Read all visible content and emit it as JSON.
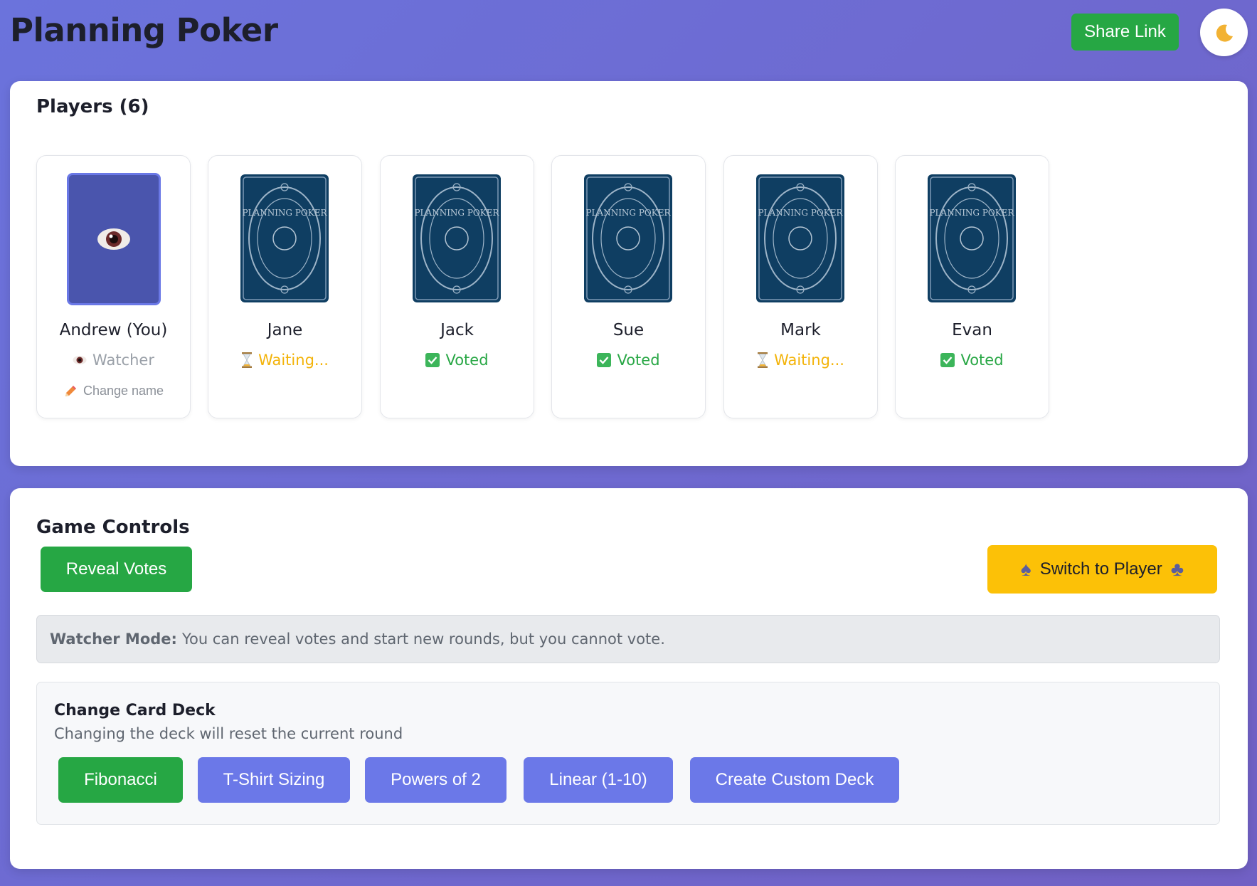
{
  "header": {
    "title": "Planning Poker",
    "share_label": "Share Link",
    "theme_icon": "moon-icon"
  },
  "players": {
    "title": "Players (6)",
    "list": [
      {
        "name": "Andrew (You)",
        "status": "Watcher",
        "status_type": "watcher",
        "card": "watcher-eye",
        "change_name": "Change name"
      },
      {
        "name": "Jane",
        "status": "Waiting...",
        "status_type": "waiting",
        "card": "card-back"
      },
      {
        "name": "Jack",
        "status": "Voted",
        "status_type": "voted",
        "card": "card-back"
      },
      {
        "name": "Sue",
        "status": "Voted",
        "status_type": "voted",
        "card": "card-back"
      },
      {
        "name": "Mark",
        "status": "Waiting...",
        "status_type": "waiting",
        "card": "card-back"
      },
      {
        "name": "Evan",
        "status": "Voted",
        "status_type": "voted",
        "card": "card-back"
      }
    ]
  },
  "controls": {
    "title": "Game Controls",
    "reveal_label": "Reveal Votes",
    "switch_label": "Switch to Player",
    "notice_bold": "Watcher Mode:",
    "notice_text": "You can reveal votes and start new rounds, but you cannot vote.",
    "deck": {
      "title": "Change Card Deck",
      "subtitle": "Changing the deck will reset the current round",
      "options": [
        {
          "label": "Fibonacci",
          "active": true
        },
        {
          "label": "T-Shirt Sizing",
          "active": false
        },
        {
          "label": "Powers of 2",
          "active": false
        },
        {
          "label": "Linear (1-10)",
          "active": false
        },
        {
          "label": "Create Custom Deck",
          "active": false
        }
      ]
    }
  },
  "colors": {
    "green": "#26a744",
    "blue_button": "#6b78e8",
    "yellow_button": "#fcc107",
    "card_back": "#0f3e62"
  },
  "card_back_text": "PLANNING POKER"
}
